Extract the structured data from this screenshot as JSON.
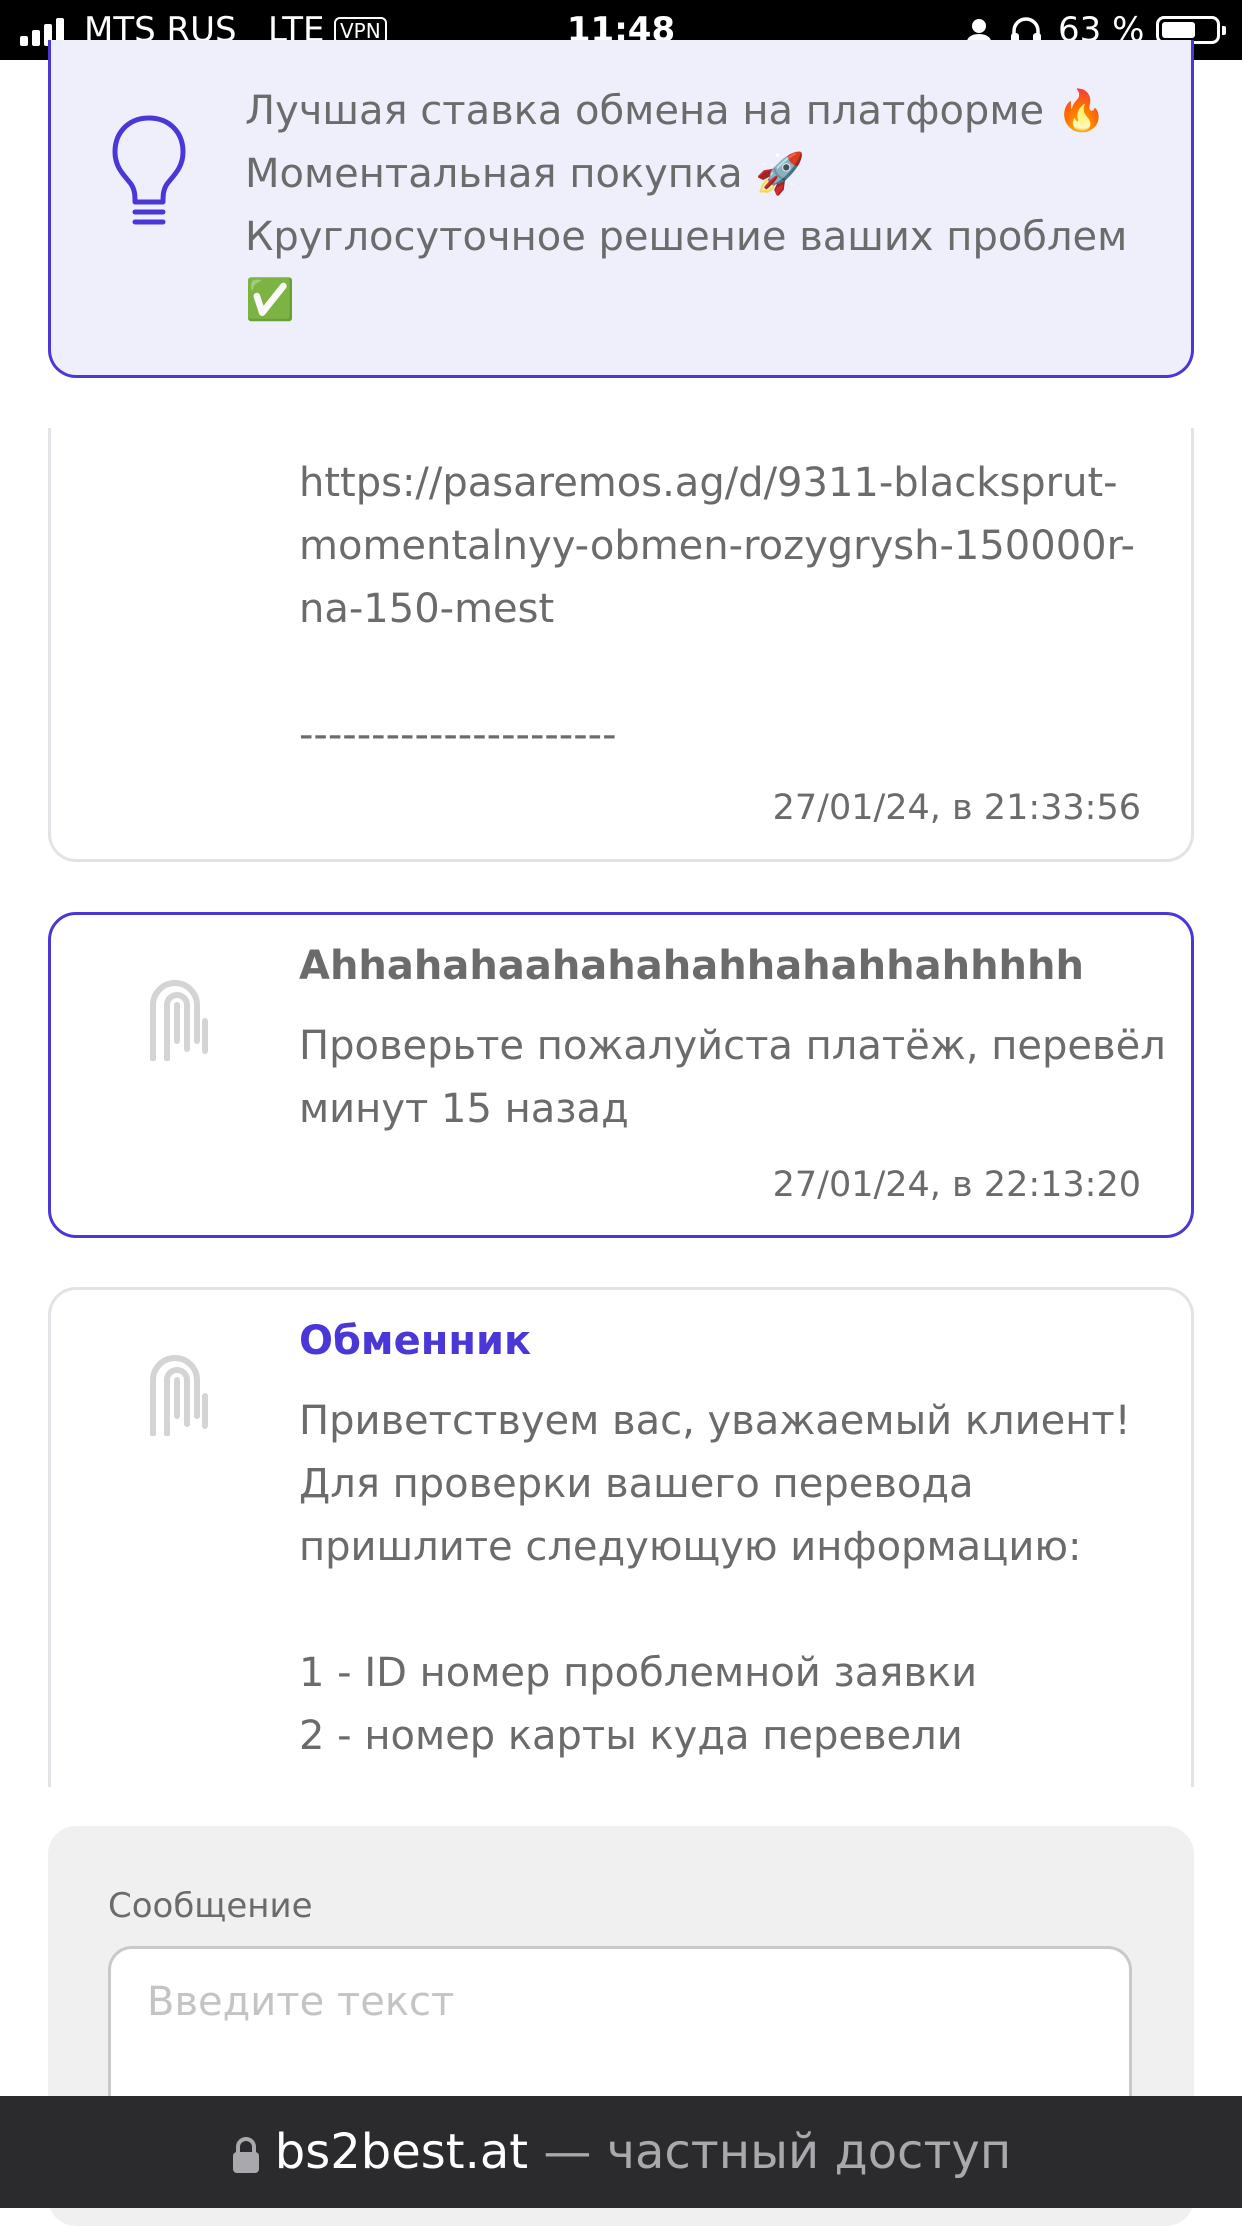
{
  "status_bar": {
    "carrier": "MTS RUS",
    "network": "LTE",
    "vpn": "VPN",
    "time": "11:48",
    "battery_percent": "63 %",
    "battery_level": 0.63,
    "icons": [
      "signal-icon",
      "person-icon",
      "headphones-icon",
      "battery-icon"
    ]
  },
  "promo": {
    "icon": "lightbulb-icon",
    "lines": [
      "Лучшая ставка обмена на платформе 🔥",
      "Моментальная покупка 🚀",
      "Круглосуточное решение ваших проблем",
      "✅"
    ]
  },
  "messages": [
    {
      "body": "https://pasaremos.ag/d/9311-blacksprut-\nmomentalnyy-obmen-rozygrysh-150000r-\nna-150-mest\n\n----------------------",
      "timestamp": "27/01/24, в 21:33:56"
    },
    {
      "author": "Ahhahahaahahahahhahahhahhhhh",
      "body": "Проверьте пожалуйста платёж, перевёл\nминут 15 назад",
      "timestamp": "27/01/24, в 22:13:20",
      "avatar_icon": "user-avatar-icon"
    },
    {
      "author": "Обменник",
      "body": "Приветствуем вас, уважаемый клиент!\nДля проверки вашего перевода\nпришлите следующую информацию:\n\n1 - ID номер проблемной заявки\n2 - номер карты куда перевели",
      "avatar_icon": "user-avatar-icon"
    }
  ],
  "compose": {
    "label": "Сообщение",
    "placeholder": "Введите текст",
    "value": ""
  },
  "url_bar": {
    "domain": "bs2best.at",
    "suffix": " — частный доступ",
    "icon": "lock-icon"
  },
  "colors": {
    "accent": "#4a37d8",
    "promo_bg": "#efeffc",
    "text": "#6b6b6b",
    "compose_bg": "#f0f0f0",
    "url_bar_bg": "#2b2b2d"
  }
}
